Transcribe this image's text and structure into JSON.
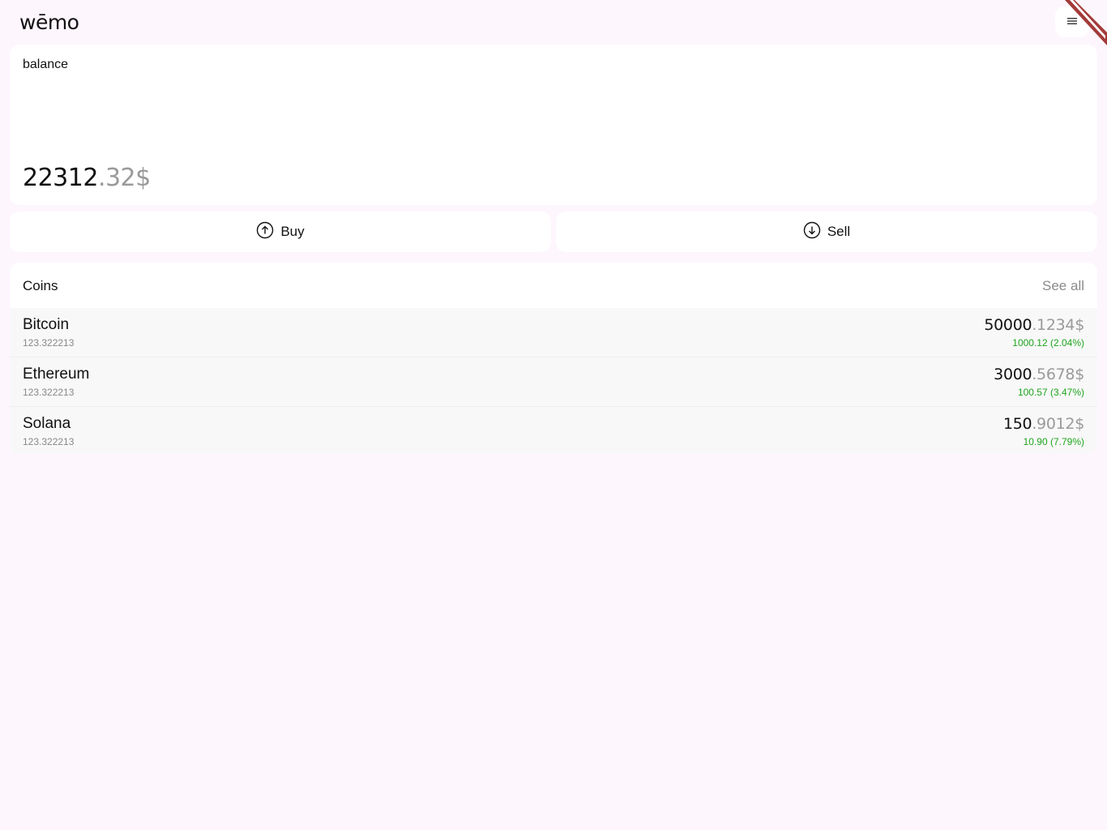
{
  "header": {
    "logo": "wēmo",
    "menu_icon": "hamburger-icon"
  },
  "balance": {
    "label": "balance",
    "integer": "22312",
    "decimal": ".32$"
  },
  "actions": {
    "buy_label": "Buy",
    "buy_icon": "arrow-up-circle-icon",
    "sell_label": "Sell",
    "sell_icon": "arrow-down-circle-icon"
  },
  "coins": {
    "title": "Coins",
    "see_all": "See all",
    "items": [
      {
        "name": "Bitcoin",
        "amount": "123.322213",
        "price_int": "50000",
        "price_dec": ".1234$",
        "change": "1000.12 (2.04%)"
      },
      {
        "name": "Ethereum",
        "amount": "123.322213",
        "price_int": "3000",
        "price_dec": ".5678$",
        "change": "100.57 (3.47%)"
      },
      {
        "name": "Solana",
        "amount": "123.322213",
        "price_int": "150",
        "price_dec": ".9012$",
        "change": "10.90 (7.79%)"
      }
    ]
  },
  "colors": {
    "background": "#fdf6fd",
    "card": "#ffffff",
    "row": "#f8f8f8",
    "positive": "#1ea51e",
    "muted": "#9a9a9a",
    "ribbon": "#a33a3a"
  }
}
